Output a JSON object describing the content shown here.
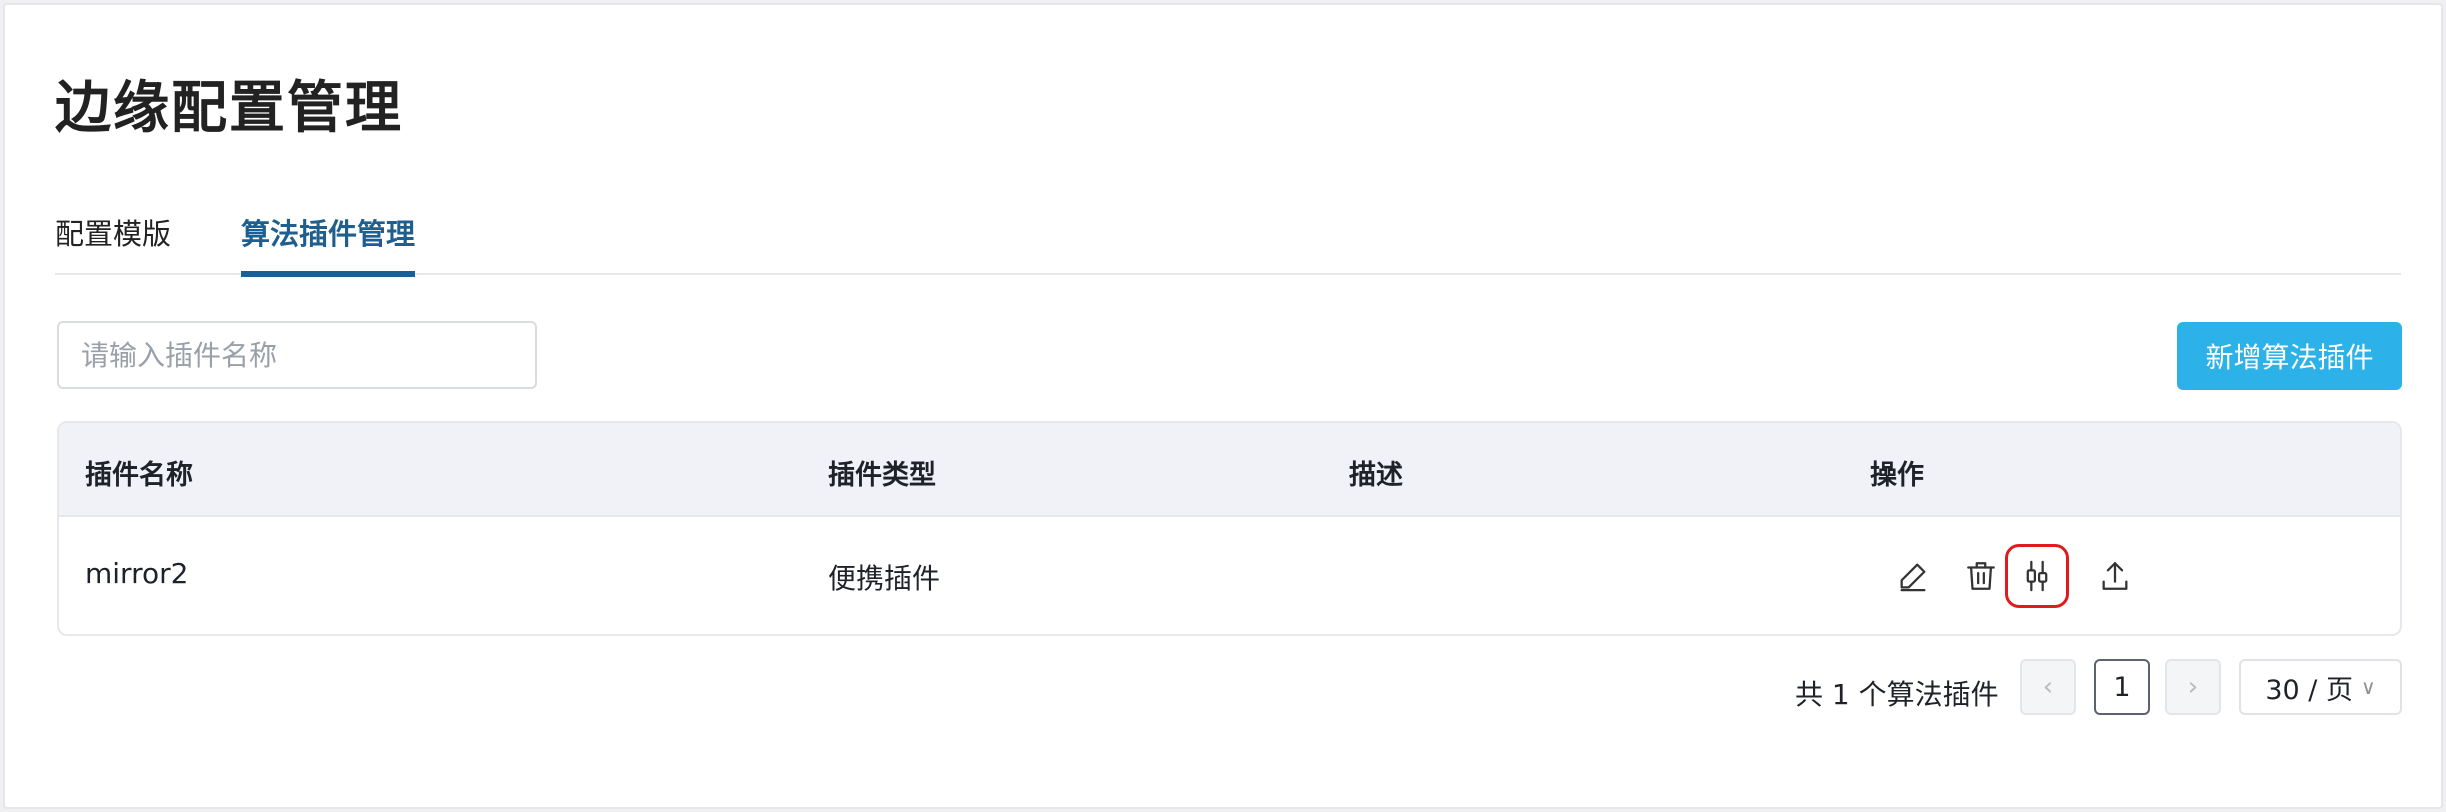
{
  "page": {
    "title": "边缘配置管理"
  },
  "tabs": [
    {
      "label": "配置模版",
      "active": false
    },
    {
      "label": "算法插件管理",
      "active": true
    }
  ],
  "search": {
    "placeholder": "请输入插件名称",
    "value": ""
  },
  "toolbar": {
    "add_label": "新增算法插件"
  },
  "table": {
    "columns": [
      "插件名称",
      "插件类型",
      "描述",
      "操作"
    ],
    "rows": [
      {
        "name": "mirror2",
        "type": "便携插件",
        "description": ""
      }
    ],
    "actions": [
      "edit-icon",
      "delete-icon",
      "adjust-icon",
      "upload-icon"
    ]
  },
  "pagination": {
    "total_text": "共 1 个算法插件",
    "current_page": "1",
    "page_size": "30 / 页"
  },
  "colors": {
    "accent": "#2cb1e8",
    "tab_active": "#1f5f8f",
    "highlight": "#e01b1b"
  }
}
